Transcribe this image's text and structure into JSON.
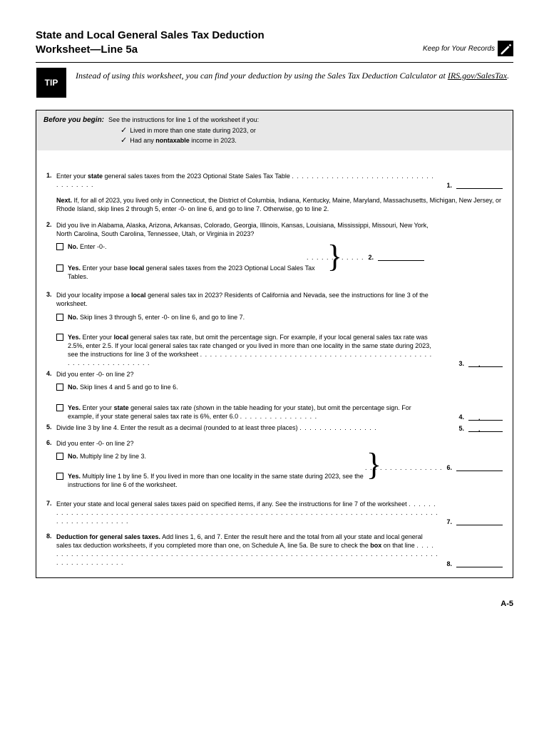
{
  "header": {
    "title_l1": "State and Local General Sales Tax Deduction",
    "title_l2": "Worksheet—Line 5a",
    "keep": "Keep for Your Records"
  },
  "tip": {
    "label": "TIP",
    "text_pre": "Instead of using this worksheet, you can find your deduction by using the Sales Tax Deduction Calculator at ",
    "link": "IRS.gov/SalesTax",
    "text_post": "."
  },
  "before": {
    "label": "Before you begin:",
    "intro": "See the instructions for line 1 of the worksheet if you:",
    "item1": "Lived in more than one state during 2023, or",
    "item2_pre": "Had any ",
    "item2_b": "nontaxable",
    "item2_post": " income in 2023."
  },
  "lines": {
    "l1_num": "1.",
    "l1_pre": "Enter your ",
    "l1_b": "state",
    "l1_post": " general sales taxes from the 2023 Optional State Sales Tax Table ",
    "l1_ans": "1.",
    "next_b": "Next.",
    "next_text": " If, for all of 2023, you lived only in Connecticut, the District of Columbia, Indiana, Kentucky, Maine, Maryland, Massachusetts, Michigan, New Jersey, or Rhode Island, skip lines 2 through 5, enter -0- on line 6, and go to line 7. Otherwise, go to line 2.",
    "l2_num": "2.",
    "l2_text": "Did you live in Alabama, Alaska, Arizona, Arkansas, Colorado, Georgia, Illinois, Kansas, Louisiana, Mississippi, Missouri, New York, North Carolina, South Carolina, Tennessee, Utah, or Virginia in 2023?",
    "l2_no_b": "No.",
    "l2_no_t": " Enter -0-.",
    "l2_yes_b": "Yes.",
    "l2_yes_pre": " Enter your base ",
    "l2_yes_b2": "local",
    "l2_yes_post": " general sales taxes from the 2023 Optional Local Sales Tax Tables.",
    "l2_ans": "2.",
    "l3_num": "3.",
    "l3_pre": "Did your locality impose a ",
    "l3_b": "local",
    "l3_post": " general sales tax in 2023? Residents of California and Nevada, see the instructions for line 3 of the worksheet.",
    "l3_no_b": "No.",
    "l3_no_t": " Skip lines 3 through 5, enter -0- on line 6, and go to line 7.",
    "l3_yes_b": "Yes.",
    "l3_yes_pre": " Enter your ",
    "l3_yes_b2": "local",
    "l3_yes_post": " general sales tax rate, but omit the percentage sign. For example, if your local general sales tax rate was 2.5%, enter 2.5. If your local general sales tax rate changed or you lived in more than one locality in the same state during 2023, see the instructions for line 3 of the worksheet ",
    "l3_ans": "3.",
    "l4_num": "4.",
    "l4_text": "Did you enter -0- on line 2?",
    "l4_no_b": "No.",
    "l4_no_t": " Skip lines 4 and 5 and go to line 6.",
    "l4_yes_b": "Yes.",
    "l4_yes_pre": " Enter your ",
    "l4_yes_b2": "state",
    "l4_yes_post": " general sales tax rate (shown in the table heading for your state), but omit the percentage sign. For example, if your state general sales tax rate is 6%, enter 6.0 ",
    "l4_ans": "4.",
    "l5_num": "5.",
    "l5_text": "Divide line 3 by line 4. Enter the result as a decimal (rounded to at least three places) ",
    "l5_ans": "5.",
    "l6_num": "6.",
    "l6_text": "Did you enter -0- on line 2?",
    "l6_no_b": "No.",
    "l6_no_t": " Multiply line 2 by line 3.",
    "l6_yes_b": "Yes.",
    "l6_yes_t": " Multiply line 1 by line 5. If you lived in more than one locality in the same state during 2023, see the instructions for line 6 of the worksheet.",
    "l6_ans": "6.",
    "l7_num": "7.",
    "l7_text": "Enter your state and local general sales taxes paid on specified items, if any. See the instructions for line 7 of the worksheet ",
    "l7_ans": "7.",
    "l8_num": "8.",
    "l8_b": "Deduction for general sales taxes.",
    "l8_pre": " Add lines 1, 6, and 7. Enter the result here and the total from all your state and local general sales tax deduction worksheets, if you completed more than one, on Schedule A, line 5a. Be sure to check the ",
    "l8_b2": "box",
    "l8_post": " on that line ",
    "l8_ans": "8."
  },
  "footer": "A-5"
}
